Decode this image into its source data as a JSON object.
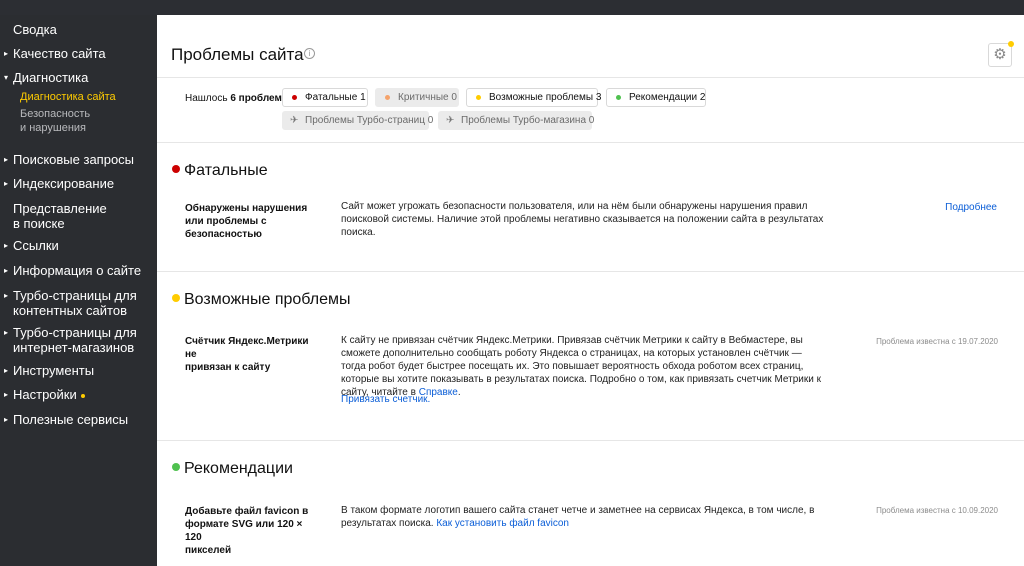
{
  "sidebar": {
    "items": [
      {
        "label": "Сводка",
        "arrow": ""
      },
      {
        "label": "Качество сайта",
        "arrow": "▸"
      },
      {
        "label": "Диагностика",
        "arrow": "▾"
      },
      {
        "label": "Поисковые запросы",
        "arrow": "▸"
      },
      {
        "label": "Индексирование",
        "arrow": "▸"
      },
      {
        "label": "Представление\nв поиске",
        "arrow": ""
      },
      {
        "label": "Ссылки",
        "arrow": "▸"
      },
      {
        "label": "Информация о сайте",
        "arrow": "▸"
      },
      {
        "label": "Турбо-страницы для\nконтентных сайтов",
        "arrow": "▸"
      },
      {
        "label": "Турбо-страницы для\nинтернет-магазинов",
        "arrow": "▸"
      },
      {
        "label": "Инструменты",
        "arrow": "▸"
      },
      {
        "label": "Настройки",
        "arrow": "▸"
      },
      {
        "label": "Полезные сервисы",
        "arrow": "▸"
      }
    ],
    "sub_items": [
      {
        "label": "Диагностика сайта"
      },
      {
        "label": "Безопасность\nи нарушения"
      }
    ]
  },
  "header": {
    "title": "Проблемы сайта",
    "info_glyph": "i",
    "gear_glyph": "⚙"
  },
  "summary": {
    "found_prefix": "Нашлось ",
    "found_count": "6 проблем"
  },
  "filters": [
    {
      "label": "Фатальные 1",
      "color": "#cc0000"
    },
    {
      "label": "Критичные 0",
      "color": "#f5a36b"
    },
    {
      "label": "Возможные проблемы 3",
      "color": "#ffcc00"
    },
    {
      "label": "Рекомендации 2",
      "color": "#4fc14f"
    }
  ],
  "turbo_filters": [
    {
      "label": "Проблемы Турбо-страниц 0",
      "icon": "rocket-icon"
    },
    {
      "label": "Проблемы Турбо-магазина 0",
      "icon": "rocket-icon"
    }
  ],
  "sections": {
    "fatal": {
      "title": "Фатальные",
      "color": "#cc0000",
      "problem": {
        "name": "Обнаружены нарушения\nили проблемы с\nбезопасностью",
        "description": "Сайт может угрожать безопасности пользователя, или на нём были обнаружены нарушения правил поисковой системы. Наличие этой проблемы негативно сказывается на положении сайта в результатах поиска.",
        "link": "Подробнее"
      }
    },
    "possible": {
      "title": "Возможные проблемы",
      "color": "#ffcc00",
      "problem": {
        "name": "Счётчик Яндекс.Метрики не\nпривязан к сайту",
        "description": "К сайту не привязан счётчик Яндекс.Метрики. Привязав счётчик Метрики к сайту в Вебмастере, вы сможете дополнительно сообщать роботу Яндекса о страницах, на которых установлен счётчик — тогда робот будет быстрее посещать их. Это повышает вероятность обхода роботом всех страниц, которые вы хотите показывать в результатах поиска. Подробно о том, как привязать счетчик Метрики к сайту, читайте в ",
        "inline_link": "Справке",
        "description_end": ".",
        "action_link": "Привязать счетчик.",
        "meta": "Проблема известна с 19.07.2020"
      }
    },
    "recommendations": {
      "title": "Рекомендации",
      "color": "#4fc14f",
      "problem": {
        "name": "Добавьте файл favicon в\nформате SVG или 120 × 120\nпикселей",
        "description": "В таком формате логотип вашего сайта станет четче и заметнее на сервисах Яндекса, в том числе, в результатах поиска. ",
        "inline_link": "Как установить файл favicon",
        "meta": "Проблема известна с 10.09.2020"
      }
    }
  }
}
